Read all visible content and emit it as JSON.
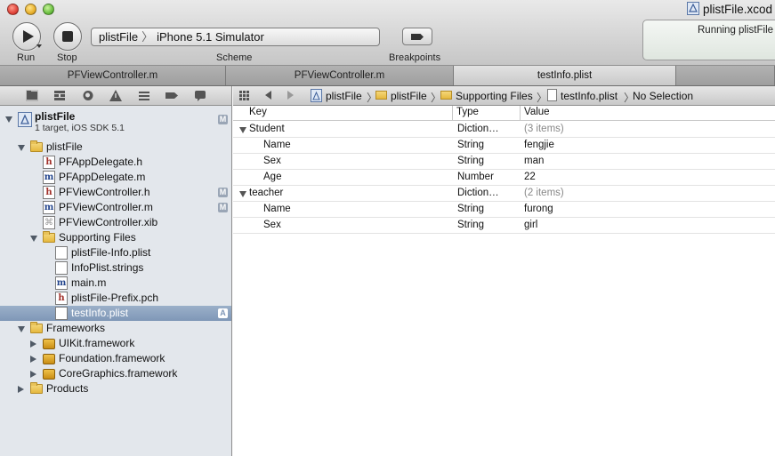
{
  "window": {
    "document_title": "plistFile.xcod",
    "activity_text": "Running plistFile"
  },
  "toolbar": {
    "run_label": "Run",
    "stop_label": "Stop",
    "scheme_label": "Scheme",
    "breakpoints_label": "Breakpoints",
    "scheme_target": "plistFile",
    "scheme_destination": "iPhone 5.1 Simulator"
  },
  "tabs": [
    {
      "label": "PFViewController.m",
      "active": false
    },
    {
      "label": "PFViewController.m",
      "active": false
    },
    {
      "label": "testInfo.plist",
      "active": true
    },
    {
      "label": "",
      "active": false
    }
  ],
  "navigator": {
    "project": {
      "name": "plistFile",
      "subtitle": "1 target, iOS SDK 5.1",
      "badge": "M"
    },
    "items": [
      {
        "label": "plistFile",
        "icon": "folder-icon",
        "disclosure": "open",
        "badge": ""
      },
      {
        "label": "PFAppDelegate.h",
        "icon": "header-file-icon",
        "badge": ""
      },
      {
        "label": "PFAppDelegate.m",
        "icon": "implementation-file-icon",
        "badge": ""
      },
      {
        "label": "PFViewController.h",
        "icon": "header-file-icon",
        "badge": "M"
      },
      {
        "label": "PFViewController.m",
        "icon": "implementation-file-icon",
        "badge": "M"
      },
      {
        "label": "PFViewController.xib",
        "icon": "xib-file-icon",
        "badge": ""
      },
      {
        "label": "Supporting Files",
        "icon": "folder-icon",
        "disclosure": "open",
        "badge": ""
      },
      {
        "label": "plistFile-Info.plist",
        "icon": "plist-file-icon",
        "badge": ""
      },
      {
        "label": "InfoPlist.strings",
        "icon": "strings-file-icon",
        "badge": ""
      },
      {
        "label": "main.m",
        "icon": "implementation-file-icon",
        "badge": ""
      },
      {
        "label": "plistFile-Prefix.pch",
        "icon": "header-file-icon",
        "badge": ""
      },
      {
        "label": "testInfo.plist",
        "icon": "plist-file-icon",
        "badge": "A",
        "selected": true
      },
      {
        "label": "Frameworks",
        "icon": "folder-icon",
        "disclosure": "open",
        "badge": ""
      },
      {
        "label": "UIKit.framework",
        "icon": "framework-icon",
        "disclosure": "closed",
        "badge": ""
      },
      {
        "label": "Foundation.framework",
        "icon": "framework-icon",
        "disclosure": "closed",
        "badge": ""
      },
      {
        "label": "CoreGraphics.framework",
        "icon": "framework-icon",
        "disclosure": "closed",
        "badge": ""
      },
      {
        "label": "Products",
        "icon": "folder-icon",
        "disclosure": "closed",
        "badge": ""
      }
    ]
  },
  "jumpbar": {
    "crumbs": [
      "plistFile",
      "plistFile",
      "Supporting Files",
      "testInfo.plist",
      "No Selection"
    ]
  },
  "plist": {
    "columns": [
      "Key",
      "Type",
      "Value"
    ],
    "rows": [
      {
        "key": "Student",
        "type": "Diction…",
        "value": "(3 items)",
        "level": 0,
        "expandable": true
      },
      {
        "key": "Name",
        "type": "String",
        "value": "fengjie",
        "level": 1
      },
      {
        "key": "Sex",
        "type": "String",
        "value": "man",
        "level": 1
      },
      {
        "key": "Age",
        "type": "Number",
        "value": "22",
        "level": 1
      },
      {
        "key": "teacher",
        "type": "Diction…",
        "value": "(2 items)",
        "level": 0,
        "expandable": true
      },
      {
        "key": "Name",
        "type": "String",
        "value": "furong",
        "level": 1
      },
      {
        "key": "Sex",
        "type": "String",
        "value": "girl",
        "level": 1
      }
    ]
  },
  "colors": {
    "selection": "#7f97b7",
    "navigator_bg": "#e3e7ec",
    "header_file": "#a0302a",
    "implementation_file": "#24468d"
  }
}
